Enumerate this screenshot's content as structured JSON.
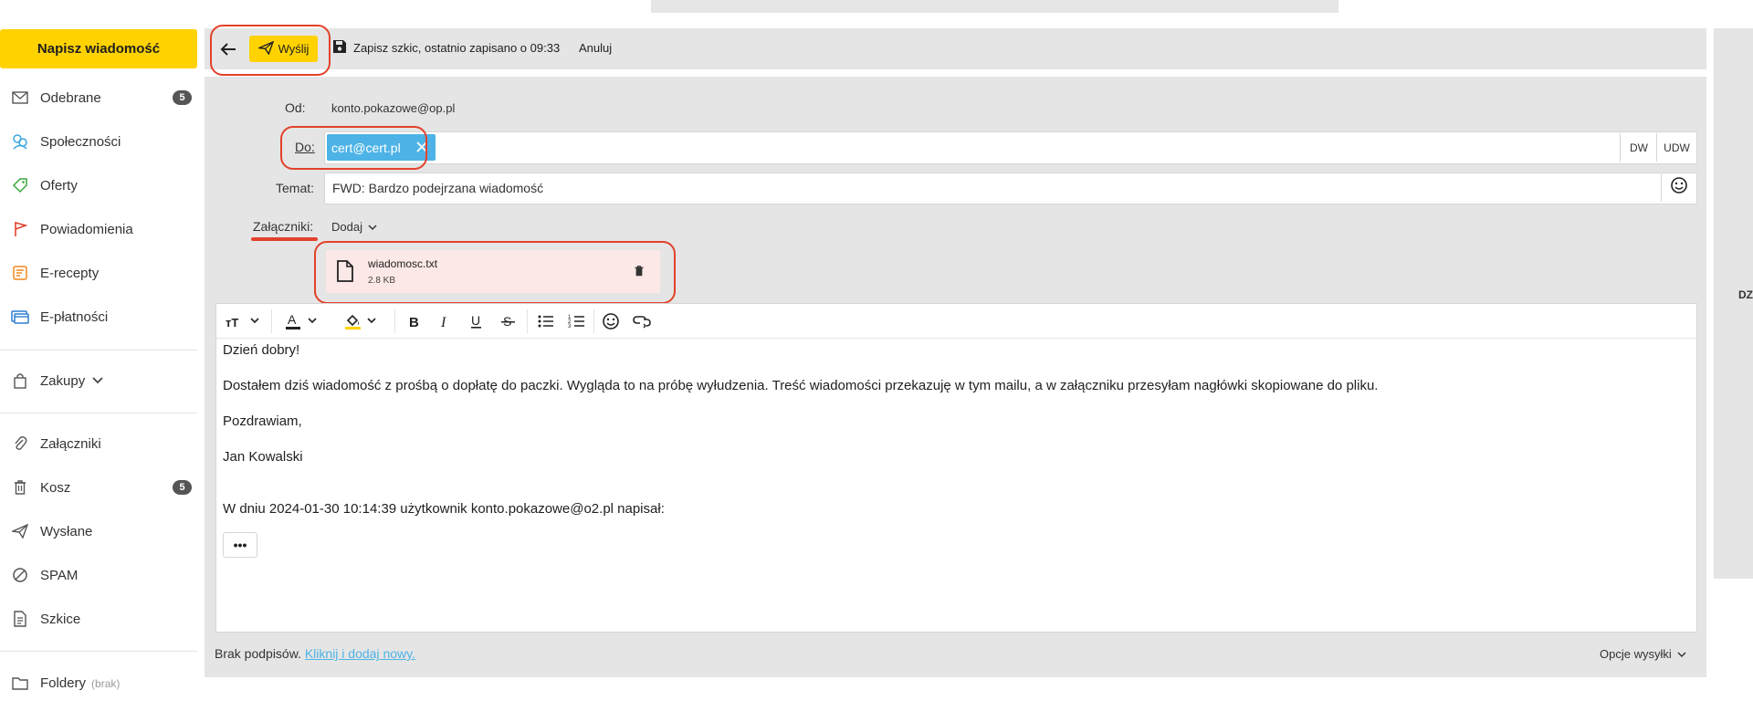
{
  "sidebar": {
    "compose_label": "Napisz wiadomość",
    "items": [
      {
        "label": "Odebrane",
        "icon": "envelope-icon",
        "badge": "5"
      },
      {
        "label": "Społeczności",
        "icon": "people-icon"
      },
      {
        "label": "Oferty",
        "icon": "tag-icon"
      },
      {
        "label": "Powiadomienia",
        "icon": "flag-icon"
      },
      {
        "label": "E-recepty",
        "icon": "prescription-icon"
      },
      {
        "label": "E-płatności",
        "icon": "payment-card-icon"
      },
      {
        "label": "Zakupy",
        "icon": "shopping-bag-icon"
      },
      {
        "label": "Załączniki",
        "icon": "paperclip-icon"
      },
      {
        "label": "Kosz",
        "icon": "trash-icon",
        "badge": "5"
      },
      {
        "label": "Wysłane",
        "icon": "paper-plane-icon"
      },
      {
        "label": "SPAM",
        "icon": "block-icon"
      },
      {
        "label": "Szkice",
        "icon": "draft-icon"
      },
      {
        "label": "Foldery",
        "icon": "folder-icon",
        "note": "(brak)"
      }
    ]
  },
  "toolbar": {
    "send_label": "Wyślij",
    "save_label": "Zapisz szkic, ostatnio zapisano o 09:33",
    "cancel_label": "Anuluj"
  },
  "form": {
    "from_label": "Od:",
    "from_value": "konto.pokazowe@op.pl",
    "to_label": "Do:",
    "to_recipient": "cert@cert.pl",
    "cc_label": "DW",
    "bcc_label": "UDW",
    "subject_label": "Temat:",
    "subject_value": "FWD: Bardzo podejrzana wiadomość",
    "attachments_label": "Załączniki:",
    "add_label": "Dodaj",
    "attachment": {
      "name": "wiadomosc.txt",
      "size": "2.8 KB"
    }
  },
  "body": {
    "greeting": "Dzień dobry!",
    "paragraph": "Dostałem dziś wiadomość z prośbą o dopłatę do paczki. Wygląda to na próbę wyłudzenia. Treść wiadomości przekazuję w tym mailu, a w załączniku przesyłam nagłówki skopiowane do pliku.",
    "closing": "Pozdrawiam,",
    "signature": "Jan Kowalski",
    "quote_header": "W dniu 2024-01-30 10:14:39 użytkownik konto.pokazowe@o2.pl napisał:",
    "more_label": "•••"
  },
  "footer": {
    "no_signature": "Brak podpisów.",
    "add_signature_link": "Kliknij i dodaj nowy.",
    "send_options": "Opcje wysyłki"
  },
  "right_panel_text": "DZ",
  "colors": {
    "accent": "#ffd200",
    "highlight": "#e2422b",
    "chip": "#4db3e6",
    "panel": "#e5e5e5"
  }
}
